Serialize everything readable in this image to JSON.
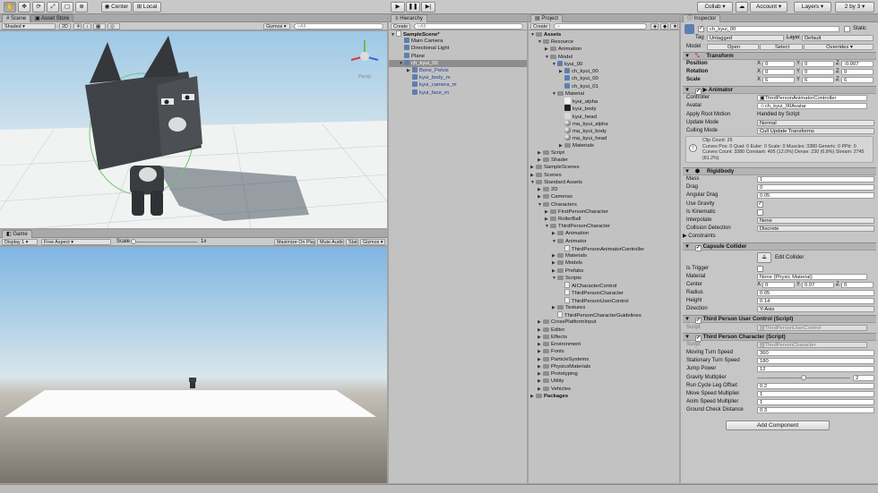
{
  "toolbar": {
    "center": "Center",
    "local": "Local",
    "collab": "Collab",
    "cloud": "☁",
    "account": "Account",
    "layers": "Layers",
    "layout": "2 by 3"
  },
  "scene": {
    "tab_scene": "Scene",
    "tab_store": "Asset Store",
    "shading": "Shaded",
    "mode2d": "2D",
    "gizmos": "Gizmos",
    "search": "All",
    "persp": "Persp"
  },
  "game": {
    "tab": "Game",
    "display": "Display 1",
    "aspect": "Free Aspect",
    "scale_label": "Scale",
    "scale_value": "1x",
    "maximize": "Maximize On Play",
    "mute": "Mute Audio",
    "stats": "Stats",
    "gizmos": "Gizmos"
  },
  "hierarchy": {
    "tab": "Hierarchy",
    "create": "Create",
    "search": "All",
    "items": [
      {
        "label": "SampleScene*",
        "depth": 0,
        "icon": "scene",
        "tri": "▼",
        "bold": true
      },
      {
        "label": "Main Camera",
        "depth": 1,
        "icon": "cube",
        "tri": ""
      },
      {
        "label": "Directional Light",
        "depth": 1,
        "icon": "cube",
        "tri": ""
      },
      {
        "label": "Plane",
        "depth": 1,
        "icon": "cube",
        "tri": ""
      },
      {
        "label": "ch_kyui_00",
        "depth": 1,
        "icon": "cube",
        "tri": "▼",
        "sel": true,
        "blue": true
      },
      {
        "label": "Bone_Pelvis",
        "depth": 2,
        "icon": "cube",
        "tri": "▶",
        "blue": true
      },
      {
        "label": "kyui_body_m",
        "depth": 2,
        "icon": "cube",
        "tri": "",
        "blue": true
      },
      {
        "label": "kyui_camera_m",
        "depth": 2,
        "icon": "cube",
        "tri": "",
        "blue": true
      },
      {
        "label": "kyui_face_m",
        "depth": 2,
        "icon": "cube",
        "tri": "",
        "blue": true
      }
    ]
  },
  "project": {
    "tab": "Project",
    "create": "Create",
    "items": [
      {
        "label": "Assets",
        "d": 0,
        "t": "▼",
        "i": "folder",
        "bold": true
      },
      {
        "label": "Resource",
        "d": 1,
        "t": "▼",
        "i": "folder"
      },
      {
        "label": "Animation",
        "d": 2,
        "t": "▶",
        "i": "folder"
      },
      {
        "label": "Model",
        "d": 2,
        "t": "▼",
        "i": "folder"
      },
      {
        "label": "kyui_00",
        "d": 3,
        "t": "▼",
        "i": "cube"
      },
      {
        "label": "ch_kyui_00",
        "d": 4,
        "t": "▶",
        "i": "cube"
      },
      {
        "label": "ch_kyui_00",
        "d": 4,
        "t": "",
        "i": "cube"
      },
      {
        "label": "ch_kyui_01",
        "d": 4,
        "t": "",
        "i": "cube"
      },
      {
        "label": "Material",
        "d": 3,
        "t": "▼",
        "i": "folder"
      },
      {
        "label": "kyui_alpha",
        "d": 4,
        "t": "",
        "i": "tex"
      },
      {
        "label": "kyui_body",
        "d": 4,
        "t": "",
        "i": "tex"
      },
      {
        "label": "kyui_head",
        "d": 4,
        "t": "",
        "i": "tex"
      },
      {
        "label": "ma_kyui_alpha",
        "d": 4,
        "t": "",
        "i": "mat"
      },
      {
        "label": "ma_kyui_body",
        "d": 4,
        "t": "",
        "i": "mat"
      },
      {
        "label": "ma_kyui_head",
        "d": 4,
        "t": "",
        "i": "mat"
      },
      {
        "label": "Materials",
        "d": 4,
        "t": "▶",
        "i": "folder"
      },
      {
        "label": "Script",
        "d": 1,
        "t": "▶",
        "i": "folder"
      },
      {
        "label": "Shader",
        "d": 1,
        "t": "▶",
        "i": "folder"
      },
      {
        "label": "SampleScenes",
        "d": 0,
        "t": "▶",
        "i": "folder"
      },
      {
        "label": "Scenes",
        "d": 0,
        "t": "▶",
        "i": "folder"
      },
      {
        "label": "Standard Assets",
        "d": 0,
        "t": "▼",
        "i": "folder"
      },
      {
        "label": "2D",
        "d": 1,
        "t": "▶",
        "i": "folder"
      },
      {
        "label": "Cameras",
        "d": 1,
        "t": "▶",
        "i": "folder"
      },
      {
        "label": "Characters",
        "d": 1,
        "t": "▼",
        "i": "folder"
      },
      {
        "label": "FirstPersonCharacter",
        "d": 2,
        "t": "▶",
        "i": "folder"
      },
      {
        "label": "RollerBall",
        "d": 2,
        "t": "▶",
        "i": "folder"
      },
      {
        "label": "ThirdPersonCharacter",
        "d": 2,
        "t": "▼",
        "i": "folder"
      },
      {
        "label": "Animation",
        "d": 3,
        "t": "▶",
        "i": "folder"
      },
      {
        "label": "Animator",
        "d": 3,
        "t": "▼",
        "i": "folder"
      },
      {
        "label": "ThirdPersonAnimatorController",
        "d": 4,
        "t": "",
        "i": "file"
      },
      {
        "label": "Materials",
        "d": 3,
        "t": "▶",
        "i": "folder"
      },
      {
        "label": "Models",
        "d": 3,
        "t": "▶",
        "i": "folder"
      },
      {
        "label": "Prefabs",
        "d": 3,
        "t": "▶",
        "i": "folder"
      },
      {
        "label": "Scripts",
        "d": 3,
        "t": "▼",
        "i": "folder"
      },
      {
        "label": "AICharacterControl",
        "d": 4,
        "t": "",
        "i": "file"
      },
      {
        "label": "ThirdPersonCharacter",
        "d": 4,
        "t": "",
        "i": "file"
      },
      {
        "label": "ThirdPersonUserControl",
        "d": 4,
        "t": "",
        "i": "file"
      },
      {
        "label": "Textures",
        "d": 3,
        "t": "▶",
        "i": "folder"
      },
      {
        "label": "ThirdPersonCharacterGuidelines",
        "d": 3,
        "t": "",
        "i": "file"
      },
      {
        "label": "CrossPlatformInput",
        "d": 1,
        "t": "▶",
        "i": "folder"
      },
      {
        "label": "Editor",
        "d": 1,
        "t": "▶",
        "i": "folder"
      },
      {
        "label": "Effects",
        "d": 1,
        "t": "▶",
        "i": "folder"
      },
      {
        "label": "Environment",
        "d": 1,
        "t": "▶",
        "i": "folder"
      },
      {
        "label": "Fonts",
        "d": 1,
        "t": "▶",
        "i": "folder"
      },
      {
        "label": "ParticleSystems",
        "d": 1,
        "t": "▶",
        "i": "folder"
      },
      {
        "label": "PhysicsMaterials",
        "d": 1,
        "t": "▶",
        "i": "folder"
      },
      {
        "label": "Prototyping",
        "d": 1,
        "t": "▶",
        "i": "folder"
      },
      {
        "label": "Utility",
        "d": 1,
        "t": "▶",
        "i": "folder"
      },
      {
        "label": "Vehicles",
        "d": 1,
        "t": "▶",
        "i": "folder"
      },
      {
        "label": "Packages",
        "d": 0,
        "t": "▶",
        "i": "folder",
        "bold": true
      }
    ]
  },
  "inspector": {
    "tab": "Inspector",
    "name": "ch_kyui_00",
    "static": "Static",
    "tag_label": "Tag",
    "tag": "Untagged",
    "layer_label": "Layer",
    "layer": "Default",
    "model_label": "Model",
    "open": "Open",
    "select": "Select",
    "overrides": "Overrides",
    "transform": {
      "title": "Transform",
      "rows": [
        {
          "label": "Position",
          "x": "0",
          "y": "0",
          "z": "-0.007"
        },
        {
          "label": "Rotation",
          "x": "0",
          "y": "0",
          "z": "0"
        },
        {
          "label": "Scale",
          "x": "6",
          "y": "6",
          "z": "6"
        }
      ]
    },
    "animator": {
      "title": "Animator",
      "controller_label": "Controller",
      "controller": "ThirdPersonAnimatorController",
      "avatar_label": "Avatar",
      "avatar": "ch_kyui_00Avatar",
      "root_label": "Apply Root Motion",
      "root": "Handled by Script",
      "update_label": "Update Mode",
      "update": "Normal",
      "culling_label": "Culling Mode",
      "culling": "Cull Update Transforms",
      "info": [
        "Clip Count: 26",
        "Curves Pos: 0 Quat: 0 Euler: 0 Scale: 0 Muscles: 3380 Generic: 0 PPtr: 0",
        "Curves Count: 3380 Constant: 405 (12.0%) Dense: 230 (6.8%) Stream: 2745",
        "(81.2%)"
      ]
    },
    "rigidbody": {
      "title": "Rigidbody",
      "rows": [
        {
          "label": "Mass",
          "value": "1"
        },
        {
          "label": "Drag",
          "value": "0"
        },
        {
          "label": "Angular Drag",
          "value": "0.05"
        }
      ],
      "gravity_label": "Use Gravity",
      "kinematic_label": "Is Kinematic",
      "interp_label": "Interpolate",
      "interp": "None",
      "collision_label": "Collision Detection",
      "collision": "Discrete",
      "constraints": "Constraints"
    },
    "capsule": {
      "title": "Capsule Collider",
      "edit": "Edit Collider",
      "trigger_label": "Is Trigger",
      "material_label": "Material",
      "material": "None (Physic Material)",
      "center_label": "Center",
      "cx": "0",
      "cy": "0.07",
      "cz": "0",
      "radius_label": "Radius",
      "radius": "0.05",
      "height_label": "Height",
      "height": "0.14",
      "direction_label": "Direction",
      "direction": "Y-Axis"
    },
    "userctrl": {
      "title": "Third Person User Control (Script)",
      "script_label": "Script",
      "script": "ThirdPersonUserControl"
    },
    "character": {
      "title": "Third Person Character (Script)",
      "script_label": "Script",
      "script": "ThirdPersonCharacter",
      "rows": [
        {
          "label": "Moving Turn Speed",
          "value": "360"
        },
        {
          "label": "Stationary Turn Speed",
          "value": "180"
        },
        {
          "label": "Jump Power",
          "value": "12"
        }
      ],
      "gravity_label": "Gravity Multiplier",
      "gravity": "2",
      "gravity_fraction": 0.5,
      "rows2": [
        {
          "label": "Run Cycle Leg Offset",
          "value": "0.2"
        },
        {
          "label": "Move Speed Multiplier",
          "value": "1"
        },
        {
          "label": "Anim Speed Multiplier",
          "value": "1"
        },
        {
          "label": "Ground Check Distance",
          "value": "0.3"
        }
      ]
    },
    "add_component": "Add Component"
  }
}
